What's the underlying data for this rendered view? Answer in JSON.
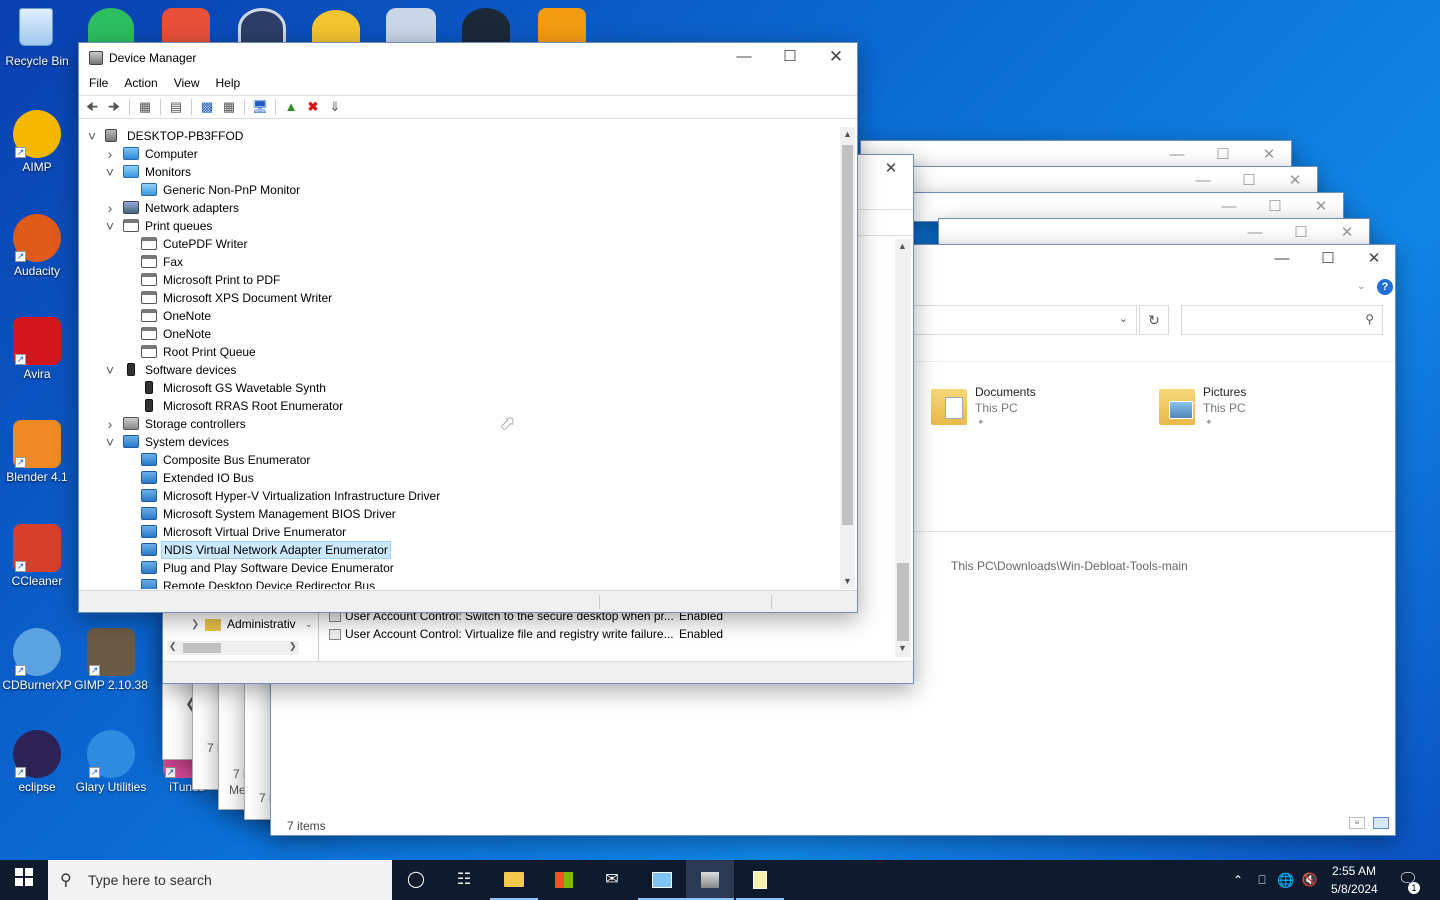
{
  "desktop": {
    "icons": [
      {
        "label": "Recycle Bin",
        "icon": "recycle-bin-icon",
        "color": "#9fc7ee"
      },
      {
        "label": "AIMP",
        "icon": "aimp-icon",
        "color": "#f5b800"
      },
      {
        "label": "Audacity",
        "icon": "audacity-icon",
        "color": "#e05a1a"
      },
      {
        "label": "Avira",
        "icon": "avira-icon",
        "color": "#d4171e"
      },
      {
        "label": "Blender 4.1",
        "icon": "blender-icon",
        "color": "#f08a24"
      },
      {
        "label": "CCleaner",
        "icon": "ccleaner-icon",
        "color": "#d63f2b"
      },
      {
        "label": "CDBurnerXP",
        "icon": "cdburnerxp-icon",
        "color": "#5aa2e0"
      },
      {
        "label": "GIMP 2.10.38",
        "icon": "gimp-icon",
        "color": "#6b5b45"
      },
      {
        "label": "eclipse",
        "icon": "eclipse-icon",
        "color": "#2c2255"
      },
      {
        "label": "Glary Utilities",
        "icon": "glary-utilities-icon",
        "color": "#2d8be0"
      },
      {
        "label": "iTunes",
        "icon": "itunes-icon",
        "color": "#e54fa3"
      }
    ]
  },
  "device_manager": {
    "title": "Device Manager",
    "menu": [
      "File",
      "Action",
      "View",
      "Help"
    ],
    "tree": [
      {
        "label": "DESKTOP-PB3FFOD",
        "level": 0,
        "expander": "open",
        "icon": "root"
      },
      {
        "label": "Computer",
        "level": 1,
        "expander": "closed",
        "icon": "pc"
      },
      {
        "label": "Monitors",
        "level": 1,
        "expander": "open",
        "icon": "mon"
      },
      {
        "label": "Generic Non-PnP Monitor",
        "level": 2,
        "expander": "",
        "icon": "mon"
      },
      {
        "label": "Network adapters",
        "level": 1,
        "expander": "closed",
        "icon": "net"
      },
      {
        "label": "Print queues",
        "level": 1,
        "expander": "open",
        "icon": "prn"
      },
      {
        "label": "CutePDF Writer",
        "level": 2,
        "expander": "",
        "icon": "prn"
      },
      {
        "label": "Fax",
        "level": 2,
        "expander": "",
        "icon": "prn"
      },
      {
        "label": "Microsoft Print to PDF",
        "level": 2,
        "expander": "",
        "icon": "prn"
      },
      {
        "label": "Microsoft XPS Document Writer",
        "level": 2,
        "expander": "",
        "icon": "prn"
      },
      {
        "label": "OneNote",
        "level": 2,
        "expander": "",
        "icon": "prn"
      },
      {
        "label": "OneNote",
        "level": 2,
        "expander": "",
        "icon": "prn"
      },
      {
        "label": "Root Print Queue",
        "level": 2,
        "expander": "",
        "icon": "prn"
      },
      {
        "label": "Software devices",
        "level": 1,
        "expander": "open",
        "icon": "sw"
      },
      {
        "label": "Microsoft GS Wavetable Synth",
        "level": 2,
        "expander": "",
        "icon": "sw"
      },
      {
        "label": "Microsoft RRAS Root Enumerator",
        "level": 2,
        "expander": "",
        "icon": "sw"
      },
      {
        "label": "Storage controllers",
        "level": 1,
        "expander": "closed",
        "icon": "sto"
      },
      {
        "label": "System devices",
        "level": 1,
        "expander": "open",
        "icon": "sys"
      },
      {
        "label": "Composite Bus Enumerator",
        "level": 2,
        "expander": "",
        "icon": "sys"
      },
      {
        "label": "Extended IO Bus",
        "level": 2,
        "expander": "",
        "icon": "sys"
      },
      {
        "label": "Microsoft Hyper-V Virtualization Infrastructure Driver",
        "level": 2,
        "expander": "",
        "icon": "sys"
      },
      {
        "label": "Microsoft System Management BIOS Driver",
        "level": 2,
        "expander": "",
        "icon": "sys"
      },
      {
        "label": "Microsoft Virtual Drive Enumerator",
        "level": 2,
        "expander": "",
        "icon": "sys"
      },
      {
        "label": "NDIS Virtual Network Adapter Enumerator",
        "level": 2,
        "expander": "",
        "icon": "sys",
        "selected": true
      },
      {
        "label": "Plug and Play Software Device Enumerator",
        "level": 2,
        "expander": "",
        "icon": "sys"
      },
      {
        "label": "Remote Desktop Device Redirector Bus",
        "level": 2,
        "expander": "",
        "icon": "sys"
      }
    ]
  },
  "policy_window": {
    "tree_item": "Administrativ",
    "rows": [
      {
        "policy": "User Account Control: Switch to the secure desktop when pr...",
        "setting": "Enabled"
      },
      {
        "policy": "User Account Control: Virtualize file and registry write failure...",
        "setting": "Enabled"
      }
    ]
  },
  "explorer": {
    "quick_access": [
      {
        "name": "Documents",
        "location": "This PC",
        "icon": "documents-folder-icon"
      },
      {
        "name": "Pictures",
        "location": "This PC",
        "icon": "pictures-folder-icon"
      }
    ],
    "recent_path": "This PC\\Downloads\\Win-Debloat-Tools-main",
    "status": "7 items",
    "behind_status": [
      "7 i",
      "7 i",
      "7 i"
    ],
    "behind_label": "Me"
  },
  "taskbar": {
    "search_placeholder": "Type here to search",
    "time": "2:55 AM",
    "date": "5/8/2024",
    "notification_count": "1"
  },
  "colors": {
    "desktop_bg": "#0b6fd6",
    "taskbar_bg": "#0e1a2d",
    "selection": "#cce8ff",
    "help_blue": "#1e6fd9"
  }
}
